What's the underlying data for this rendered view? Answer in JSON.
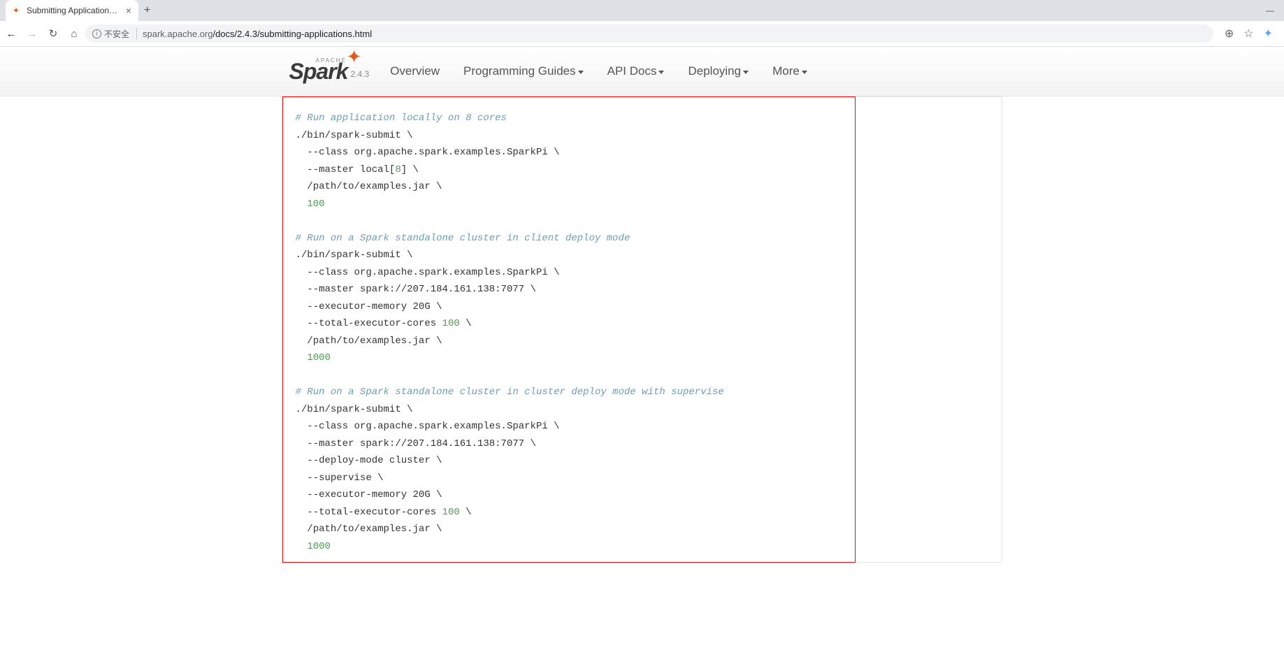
{
  "browser": {
    "tab_title": "Submitting Applications - Spa",
    "url_security_label": "不安全",
    "url_host": "spark.apache.org",
    "url_path": "/docs/2.4.3/submitting-applications.html"
  },
  "navbar": {
    "brand_apache": "APACHE",
    "brand_name": "Spark",
    "brand_tm": "™",
    "version": "2.4.3",
    "items": [
      {
        "label": "Overview",
        "dropdown": false
      },
      {
        "label": "Programming Guides",
        "dropdown": true
      },
      {
        "label": "API Docs",
        "dropdown": true
      },
      {
        "label": "Deploying",
        "dropdown": true
      },
      {
        "label": "More",
        "dropdown": true
      }
    ]
  },
  "code": {
    "blocks": [
      {
        "comment": "# Run application locally on 8 cores",
        "lines": [
          {
            "text": "./bin/spark-submit ",
            "cont": true
          },
          {
            "indent": "  ",
            "text": "--class org.apache.spark.examples.SparkPi ",
            "cont": true
          },
          {
            "indent": "  ",
            "text": "--master local",
            "bracket_num": "8",
            "post": " ",
            "cont": true
          },
          {
            "indent": "  ",
            "text": "/path/to/examples.jar ",
            "cont": true
          },
          {
            "indent": "  ",
            "number": "100"
          }
        ]
      },
      {
        "comment": "# Run on a Spark standalone cluster in client deploy mode",
        "lines": [
          {
            "text": "./bin/spark-submit ",
            "cont": true
          },
          {
            "indent": "  ",
            "text": "--class org.apache.spark.examples.SparkPi ",
            "cont": true
          },
          {
            "indent": "  ",
            "text": "--master spark://207.184.161.138:7077 ",
            "cont": true
          },
          {
            "indent": "  ",
            "text": "--executor-memory 20G ",
            "cont": true
          },
          {
            "indent": "  ",
            "text": "--total-executor-cores ",
            "number": "100",
            "post": " ",
            "cont": true
          },
          {
            "indent": "  ",
            "text": "/path/to/examples.jar ",
            "cont": true
          },
          {
            "indent": "  ",
            "number": "1000"
          }
        ]
      },
      {
        "comment": "# Run on a Spark standalone cluster in cluster deploy mode with supervise",
        "lines": [
          {
            "text": "./bin/spark-submit ",
            "cont": true
          },
          {
            "indent": "  ",
            "text": "--class org.apache.spark.examples.SparkPi ",
            "cont": true
          },
          {
            "indent": "  ",
            "text": "--master spark://207.184.161.138:7077 ",
            "cont": true
          },
          {
            "indent": "  ",
            "text": "--deploy-mode cluster ",
            "cont": true
          },
          {
            "indent": "  ",
            "text": "--supervise ",
            "cont": true
          },
          {
            "indent": "  ",
            "text": "--executor-memory 20G ",
            "cont": true
          },
          {
            "indent": "  ",
            "text": "--total-executor-cores ",
            "number": "100",
            "post": " ",
            "cont": true
          },
          {
            "indent": "  ",
            "text": "/path/to/examples.jar ",
            "cont": true
          },
          {
            "indent": "  ",
            "number": "1000"
          }
        ]
      }
    ]
  }
}
